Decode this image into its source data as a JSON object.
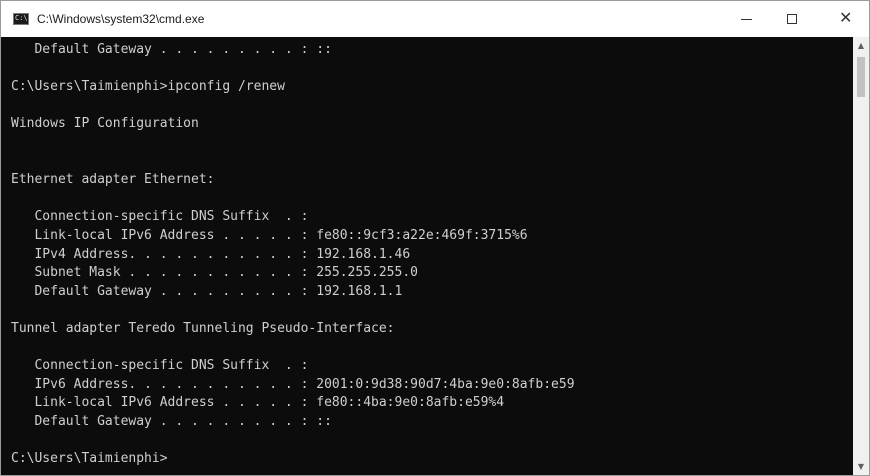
{
  "window": {
    "title": "C:\\Windows\\system32\\cmd.exe",
    "icon": "console-icon",
    "icon_glyph": "C:\\",
    "controls": {
      "minimize": "minimize-icon",
      "maximize": "maximize-icon",
      "close": "close-icon",
      "close_glyph": "✕"
    }
  },
  "console": {
    "lines": [
      "   Default Gateway . . . . . . . . . : ::",
      "",
      "C:\\Users\\Taimienphi>ipconfig /renew",
      "",
      "Windows IP Configuration",
      "",
      "",
      "Ethernet adapter Ethernet:",
      "",
      "   Connection-specific DNS Suffix  . :",
      "   Link-local IPv6 Address . . . . . : fe80::9cf3:a22e:469f:3715%6",
      "   IPv4 Address. . . . . . . . . . . : 192.168.1.46",
      "   Subnet Mask . . . . . . . . . . . : 255.255.255.0",
      "   Default Gateway . . . . . . . . . : 192.168.1.1",
      "",
      "Tunnel adapter Teredo Tunneling Pseudo-Interface:",
      "",
      "   Connection-specific DNS Suffix  . :",
      "   IPv6 Address. . . . . . . . . . . : 2001:0:9d38:90d7:4ba:9e0:8afb:e59",
      "   Link-local IPv6 Address . . . . . : fe80::4ba:9e0:8afb:e59%4",
      "   Default Gateway . . . . . . . . . : ::",
      "",
      "C:\\Users\\Taimienphi>"
    ]
  },
  "scrollbar": {
    "up_glyph": "▲",
    "down_glyph": "▼"
  },
  "colors": {
    "console_background": "#0c0c0c",
    "console_text": "#cfcfcf",
    "titlebar": "#ffffff"
  }
}
